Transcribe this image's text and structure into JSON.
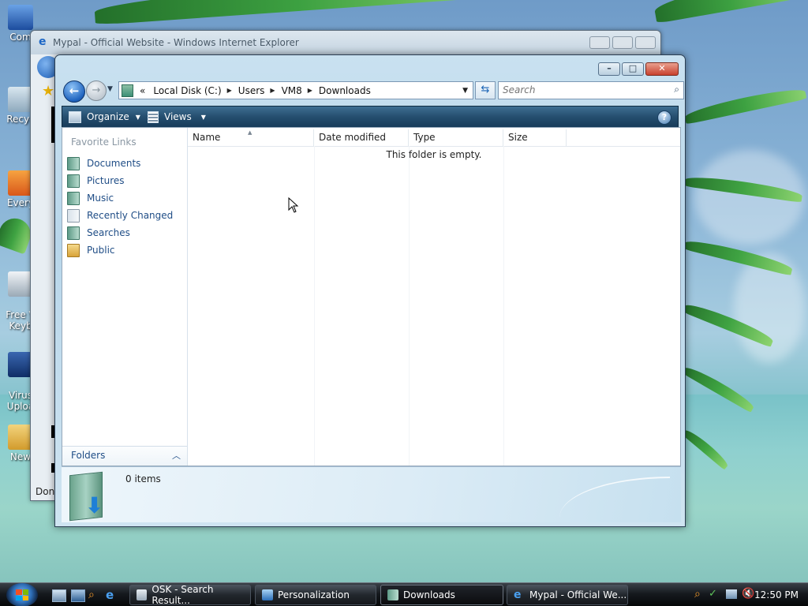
{
  "desktop": {
    "icons": [
      {
        "label": "Com"
      },
      {
        "label": "Recyc"
      },
      {
        "label": "Every"
      },
      {
        "label": "Free V\nKeyb"
      },
      {
        "label": "Virus\nUploa"
      },
      {
        "label": "New"
      }
    ]
  },
  "ie_window": {
    "title": "Mypal - Official Website - Windows Internet Explorer",
    "status": "Don"
  },
  "explorer": {
    "breadcrumb": {
      "overflow": "«",
      "items": [
        "Local Disk (C:)",
        "Users",
        "VM8",
        "Downloads"
      ]
    },
    "search": {
      "placeholder": "Search"
    },
    "commands": {
      "organize": "Organize",
      "views": "Views"
    },
    "favorite_links": {
      "heading": "Favorite Links",
      "items": [
        {
          "label": "Documents",
          "icon": "documents-icon"
        },
        {
          "label": "Pictures",
          "icon": "pictures-icon"
        },
        {
          "label": "Music",
          "icon": "music-icon"
        },
        {
          "label": "Recently Changed",
          "icon": "recently-changed-icon"
        },
        {
          "label": "Searches",
          "icon": "searches-icon"
        },
        {
          "label": "Public",
          "icon": "public-folder-icon"
        }
      ]
    },
    "folders_label": "Folders",
    "columns": [
      "Name",
      "Date modified",
      "Type",
      "Size"
    ],
    "empty_message": "This folder is empty.",
    "item_count": "0 items"
  },
  "taskbar": {
    "tasks": [
      {
        "label": "OSK - Search Result...",
        "icon": "osk-icon",
        "active": false
      },
      {
        "label": "Personalization",
        "icon": "personalization-icon",
        "active": false
      },
      {
        "label": "Downloads",
        "icon": "folder-icon",
        "active": true
      },
      {
        "label": "Mypal - Official We...",
        "icon": "ie-icon",
        "active": false
      }
    ],
    "clock": "12:50 PM"
  },
  "colors": {
    "link": "#1f4d86",
    "command_bar": "#254e6f",
    "close_button": "#c9412d"
  }
}
